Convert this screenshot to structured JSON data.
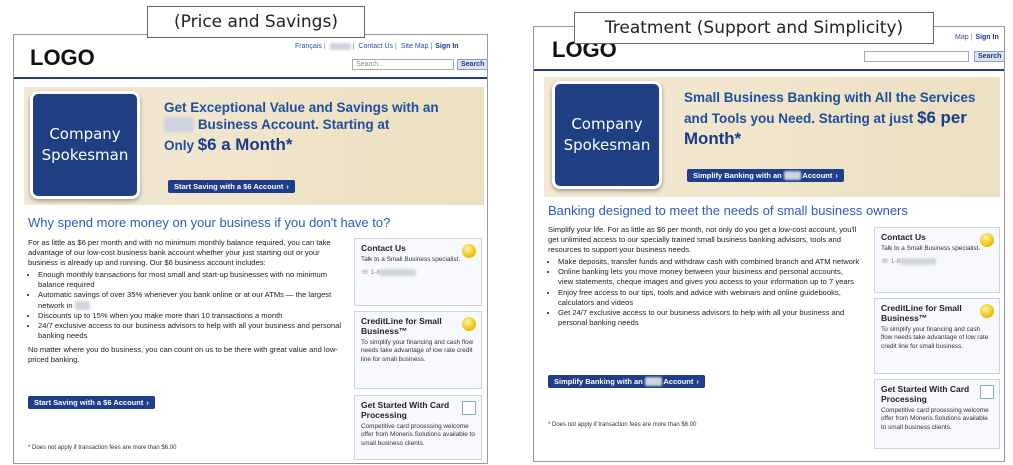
{
  "captions": {
    "left": "(Price and Savings)",
    "right": "Treatment (Support and Simplicity)"
  },
  "left": {
    "logo": "LOGO",
    "toplinks": {
      "francais": "Français",
      "contact": "Contact Us",
      "sitemap": "Site Map",
      "signin": "Sign In"
    },
    "search_placeholder": "Search...",
    "search_button": "Search",
    "spokesman": "Company Spokesman",
    "headline_pre": "Get Exceptional Value and Savings with an",
    "headline_mid": "Business Account.  Starting at",
    "headline_only": "Only",
    "headline_price": "$6 a Month*",
    "hero_cta": "Start Saving with a $6 Account",
    "subhead": "Why spend more money on your business if you don't have to?",
    "intro": "For as little as $6 per month and with no minimum monthly balance required, you can take advantage of our low-cost business bank account whether your just starting out or your business is already up and running. Our $6 business account includes:",
    "bullets": [
      "Enough monthly transactions for most small and start-up businesses with no minimum balance required",
      "Automatic savings of over 35% whenever you bank online or at our ATMs — the largest network in",
      "Discounts up to 15% when you make more than 10 transactions a month",
      "24/7 exclusive access to our business advisors to help with all your business and personal banking needs"
    ],
    "closing": "No matter where you do business, you can count on us to be there with great value and low-priced banking.",
    "body_cta": "Start Saving with a $6 Account",
    "footnote": "* Does not apply if transaction fees are more than $6.00",
    "sidebar": [
      {
        "title": "Contact Us",
        "text": "Talk to a Small Business specialist.",
        "phone": "1-8"
      },
      {
        "title": "CreditLine for Small Business™",
        "text": "To simplify your financing and cash flow needs take advantage of low rate credit line for small business."
      },
      {
        "title": "Get Started With Card Processing",
        "text": "Competitive card processing welcome offer from Moneris Solutions available to small business clients."
      }
    ]
  },
  "right": {
    "logo": "LOGO",
    "toplinks": {
      "sitemap": "Map",
      "signin": "Sign In"
    },
    "search_button": "Search",
    "spokesman": "Company Spokesman",
    "headline": "Small Business Banking with All the Services and Tools you Need.  Starting at",
    "headline_just": "just",
    "headline_price": "$6 per Month*",
    "hero_cta": "Simplify Banking with an",
    "hero_cta_tail": "Account",
    "subhead": "Banking designed to meet the needs of small business owners",
    "intro": "Simplify your life. For as little as $6 per month, not only do you get a low-cost account, you'll get unlimited access to our specially trained small business banking advisors, tools and resources to support your business needs.",
    "bullets": [
      "Make deposits, transfer funds and withdraw cash with combined branch and ATM network",
      "Online banking lets you move money between your business and personal accounts, view statements, cheque images and gives you access to your information up to 7 years",
      "Enjoy free access to our tips, tools and advice with webinars and online guidebooks, calculators and videos",
      "Get 24/7 exclusive access to our business advisors to help with all your business and personal banking needs"
    ],
    "body_cta": "Simplify Banking with an",
    "body_cta_tail": "Account",
    "footnote": "* Does not apply if transaction fees are more than $6.00",
    "sidebar": [
      {
        "title": "Contact Us",
        "text": "Talk to a Small Business specialist.",
        "phone": "1-8"
      },
      {
        "title": "CreditLine for Small Business™",
        "text": "To simplify your financing and cash flow needs take advantage of low rate credit line for small business."
      },
      {
        "title": "Get Started With Card Processing",
        "text": "Competitive card processing welcome offer from Moneris Solutions available to small business clients."
      }
    ]
  }
}
